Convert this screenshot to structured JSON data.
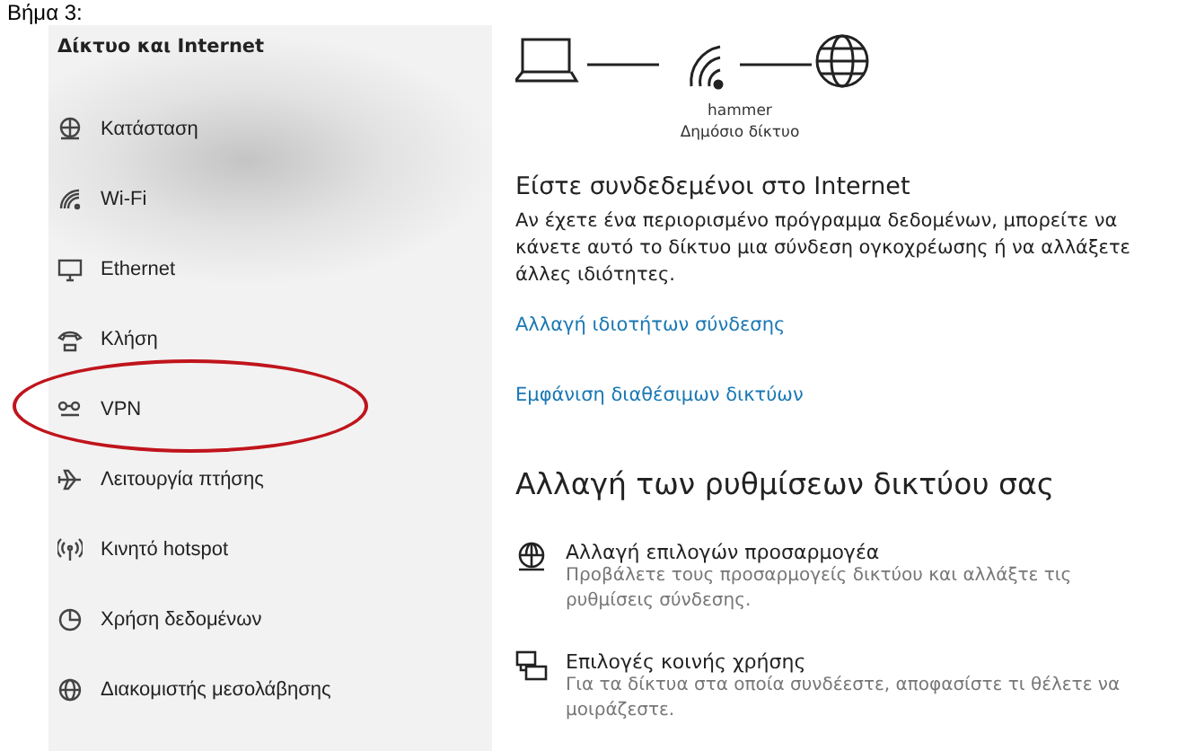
{
  "caption": "Βήμα 3:",
  "sidebar": {
    "title": "Δίκτυο και Internet",
    "items": [
      {
        "label": "Κατάσταση",
        "circled": false
      },
      {
        "label": "Wi-Fi",
        "circled": false
      },
      {
        "label": "Ethernet",
        "circled": false
      },
      {
        "label": "Κλήση",
        "circled": false
      },
      {
        "label": "VPN",
        "circled": true
      },
      {
        "label": "Λειτουργία πτήσης",
        "circled": false
      },
      {
        "label": "Κινητό hotspot",
        "circled": false
      },
      {
        "label": "Χρήση δεδομένων",
        "circled": false
      },
      {
        "label": "Διακομιστής μεσολάβησης",
        "circled": false
      }
    ]
  },
  "status": {
    "network_name": "hammer",
    "network_type": "Δημόσιο δίκτυο",
    "heading": "Είστε συνδεδεμένοι στο Internet",
    "description": "Αν έχετε ένα περιορισμένο πρόγραμμα δεδομένων, μπορείτε να κάνετε αυτό το δίκτυο μια σύνδεση ογκοχρέωσης ή να αλλάξετε άλλες ιδιότητες.",
    "links": [
      "Αλλαγή ιδιοτήτων σύνδεσης",
      "Εμφάνιση διαθέσιμων δικτύων"
    ]
  },
  "settings": {
    "heading": "Αλλαγή των ρυθμίσεων δικτύου σας",
    "options": [
      {
        "title": "Αλλαγή επιλογών προσαρμογέα",
        "description": "Προβάλετε τους προσαρμογείς δικτύου και αλλάξτε τις ρυθμίσεις σύνδεσης."
      },
      {
        "title": "Επιλογές κοινής χρήσης",
        "description": "Για τα δίκτυα στα οποία συνδέεστε, αποφασίστε τι θέλετε να μοιράζεστε."
      }
    ]
  }
}
